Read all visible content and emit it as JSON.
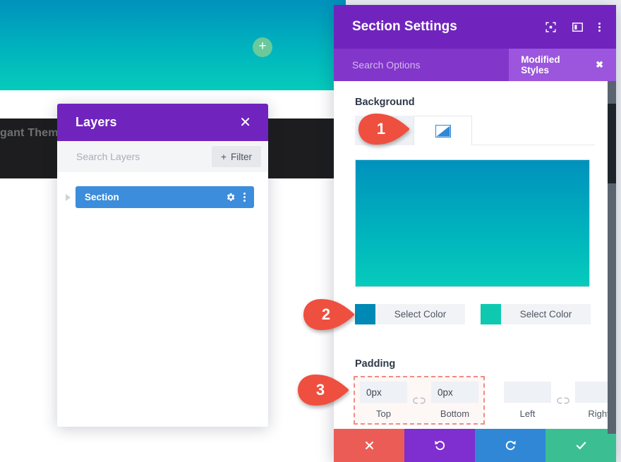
{
  "canvas": {
    "dark_band_text": "gant Theme",
    "add_button_label": "+",
    "hero_gradient_top": "#0092bd",
    "hero_gradient_bottom": "#06cbbb"
  },
  "layers_panel": {
    "title": "Layers",
    "close_label": "✕",
    "search_placeholder": "Search Layers",
    "search_value": "",
    "filter_label": "Filter",
    "filter_plus": "+",
    "rows": [
      {
        "name": "Section",
        "selected_color": "#3c8ddb"
      }
    ]
  },
  "settings_panel": {
    "title": "Section Settings",
    "header_icons": [
      "expand-icon",
      "layout-icon",
      "more-vertical-icon"
    ],
    "search_placeholder": "Search Options",
    "search_value": "",
    "modified_chip_label": "Modified Styles",
    "modified_chip_close": "✖",
    "background": {
      "label": "Background",
      "tabs": [
        {
          "name": "color-tab",
          "active": false
        },
        {
          "name": "gradient-tab",
          "active": true
        }
      ],
      "gradient_preview_top": "#0091bd",
      "gradient_preview_bottom": "#06cbbb",
      "colors": [
        {
          "swatch": "#0089b5",
          "button_label": "Select Color"
        },
        {
          "swatch": "#0ec9b0",
          "button_label": "Select Color"
        }
      ]
    },
    "padding": {
      "label": "Padding",
      "fields": [
        {
          "sublabel": "Top",
          "value": "0px",
          "placeholder": ""
        },
        {
          "sublabel": "Bottom",
          "value": "0px",
          "placeholder": ""
        },
        {
          "sublabel": "Left",
          "value": "",
          "placeholder": ""
        },
        {
          "sublabel": "Right",
          "value": "",
          "placeholder": ""
        }
      ],
      "link_icon": "broken-link-icon"
    },
    "footer_buttons": [
      {
        "name": "cancel-button",
        "color": "#ec5c56",
        "icon": "close-icon"
      },
      {
        "name": "undo-button",
        "color": "#7f2ecf",
        "icon": "undo-icon"
      },
      {
        "name": "redo-button",
        "color": "#2f87d6",
        "icon": "redo-icon"
      },
      {
        "name": "save-button",
        "color": "#3bbf92",
        "icon": "check-icon"
      }
    ]
  },
  "markers": [
    {
      "number": "1"
    },
    {
      "number": "2"
    },
    {
      "number": "3"
    }
  ]
}
